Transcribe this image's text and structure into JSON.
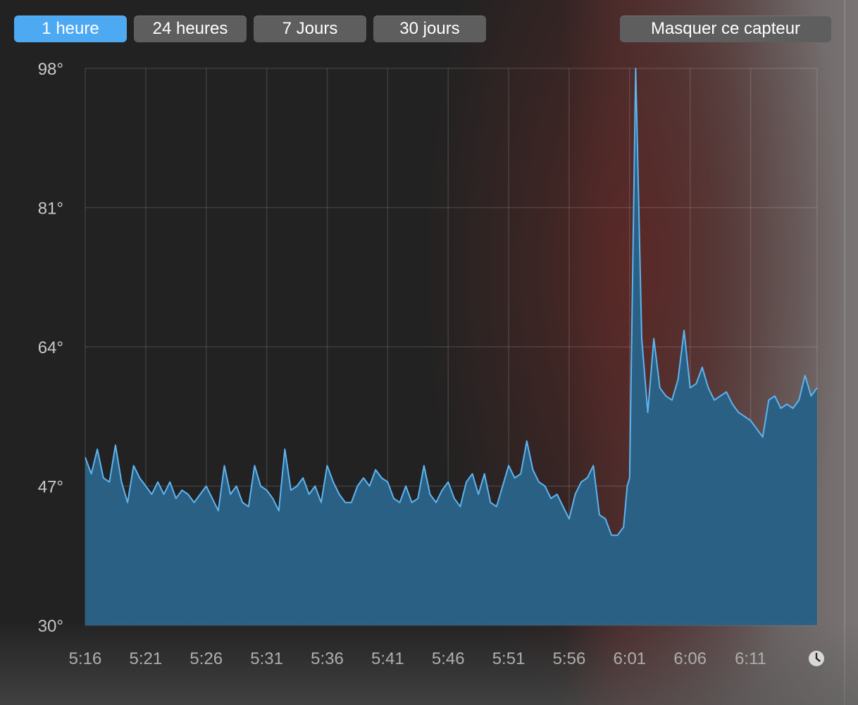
{
  "toolbar": {
    "tabs": [
      {
        "label": "1 heure",
        "active": true
      },
      {
        "label": "24 heures",
        "active": false
      },
      {
        "label": "7 Jours",
        "active": false
      },
      {
        "label": "30 jours",
        "active": false
      }
    ],
    "hide_sensor_label": "Masquer ce capteur",
    "accent_color": "#4ea9f3"
  },
  "footer": {
    "clock_icon": "clock-icon"
  },
  "chart_data": {
    "type": "area",
    "title": "",
    "xlabel": "",
    "ylabel": "",
    "y_ticks": [
      "98°",
      "81°",
      "64°",
      "47°",
      "30°"
    ],
    "y_tick_values": [
      98,
      81,
      64,
      47,
      30
    ],
    "x_ticks": [
      "5:16",
      "5:21",
      "5:26",
      "5:31",
      "5:36",
      "5:41",
      "5:46",
      "5:51",
      "5:56",
      "6:01",
      "6:06",
      "6:11"
    ],
    "ylim": [
      30,
      98
    ],
    "xlim_minutes": [
      0,
      60.5
    ],
    "grid": true,
    "line_color": "#5db4f0",
    "fill_color": "#2b6085",
    "series": [
      {
        "segments": [
          {
            "x": [
              0,
              0.5,
              1,
              1.5,
              2,
              2.5,
              3,
              3.5,
              4,
              4.5,
              5,
              5.5,
              6,
              6.5,
              7,
              7.5,
              8,
              8.5,
              9,
              9.5,
              10,
              10.5,
              11,
              11.5,
              12,
              12.5,
              13,
              13.5,
              14,
              14.5,
              15,
              15.5,
              16,
              16.5,
              17,
              17.5,
              18,
              18.5,
              19,
              19.5,
              20,
              20.5,
              21,
              21.5,
              22,
              22.5,
              23,
              23.5,
              24,
              24.5,
              25,
              25.5,
              26,
              26.5,
              27,
              27.5,
              28,
              28.5,
              29,
              29.5,
              30,
              30.5,
              31,
              31.5,
              32,
              32.5,
              33,
              33.5,
              34,
              34.5,
              35,
              35.5,
              36,
              36.5,
              37,
              37.5,
              38,
              38.5,
              39,
              39.5,
              40,
              40.5,
              41,
              41.5,
              42,
              42.5,
              43,
              43.5
            ],
            "y": [
              50.5,
              48.5,
              51.5,
              48,
              47.5,
              52,
              47.5,
              45,
              49.5,
              48,
              47,
              46,
              47.5,
              46,
              47.5,
              45.5,
              46.5,
              46,
              45,
              46,
              47,
              45.5,
              44,
              49.5,
              46,
              47,
              45,
              44.5,
              49.5,
              47,
              46.5,
              45.5,
              44,
              51.5,
              46.5,
              47,
              48,
              46,
              47,
              45,
              49.5,
              47.5,
              46,
              45,
              45,
              47,
              48,
              47,
              49,
              48,
              47.5,
              45.5,
              45,
              47,
              45,
              45.5,
              49.5,
              46,
              45,
              46.5,
              47.5,
              45.5,
              44.5,
              47.5,
              48.5,
              46,
              48.5,
              45,
              44.5,
              47,
              49.5,
              48,
              48.5,
              52.5,
              49,
              47.5,
              47,
              45.5,
              46,
              44.5,
              43,
              46,
              47.5,
              48,
              49.5,
              43.5,
              43,
              41
            ]
          },
          {
            "x": [
              43.5,
              44,
              44.5,
              44.8,
              45,
              45.5,
              46,
              46.5,
              47,
              47.5,
              48,
              48.5,
              49,
              49.5,
              50,
              50.5,
              51,
              51.5,
              52,
              52.5,
              53,
              53.5,
              54,
              54.5,
              55,
              55.5,
              56,
              56.5,
              57,
              57.5,
              58,
              58.5,
              59,
              59.5,
              60,
              60.5
            ],
            "y": [
              41,
              41,
              42,
              47,
              48,
              98,
              65,
              56,
              65,
              59,
              58,
              57.5,
              60,
              66,
              59,
              59.5,
              61.5,
              59,
              57.5,
              58,
              58.5,
              57,
              56,
              55.5,
              55,
              54,
              53,
              57.5,
              58,
              56.5,
              57,
              56.5,
              57.5,
              60.5,
              58,
              59
            ]
          }
        ]
      }
    ]
  }
}
